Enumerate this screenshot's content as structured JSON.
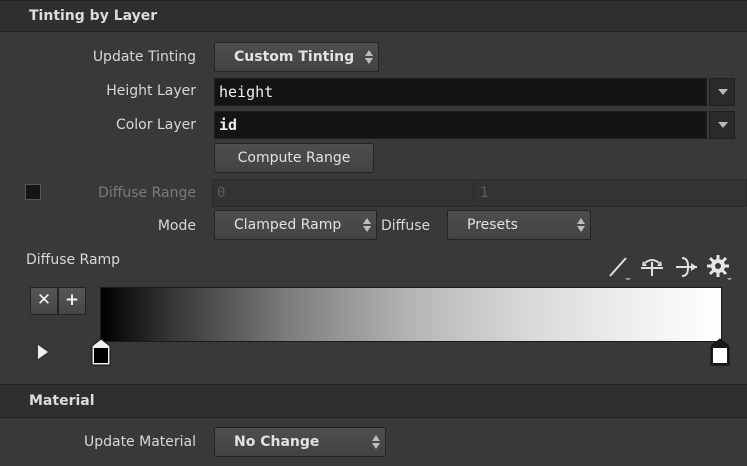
{
  "tinting_section": {
    "title": "Tinting by Layer",
    "update_tinting_label": "Update Tinting",
    "update_tinting_value": "Custom Tinting",
    "height_layer_label": "Height Layer",
    "height_layer_value": "height",
    "color_layer_label": "Color Layer",
    "color_layer_value": "id",
    "compute_range_label": "Compute Range",
    "diffuse_range_label": "Diffuse Range",
    "diffuse_range_min": "0",
    "diffuse_range_max": "1",
    "diffuse_range_enabled": false,
    "mode_label": "Mode",
    "mode_value": "Clamped Ramp",
    "diffuse_label": "Diffuse",
    "presets_value": "Presets",
    "diffuse_ramp_label": "Diffuse Ramp",
    "ramp_colors": {
      "start": "#000000",
      "end": "#ffffff"
    },
    "ramp_tools": [
      "interpolation-line-icon",
      "flip-icon",
      "spread-icon",
      "gear-icon"
    ]
  },
  "material_section": {
    "title": "Material",
    "update_material_label": "Update Material",
    "update_material_value": "No Change"
  }
}
